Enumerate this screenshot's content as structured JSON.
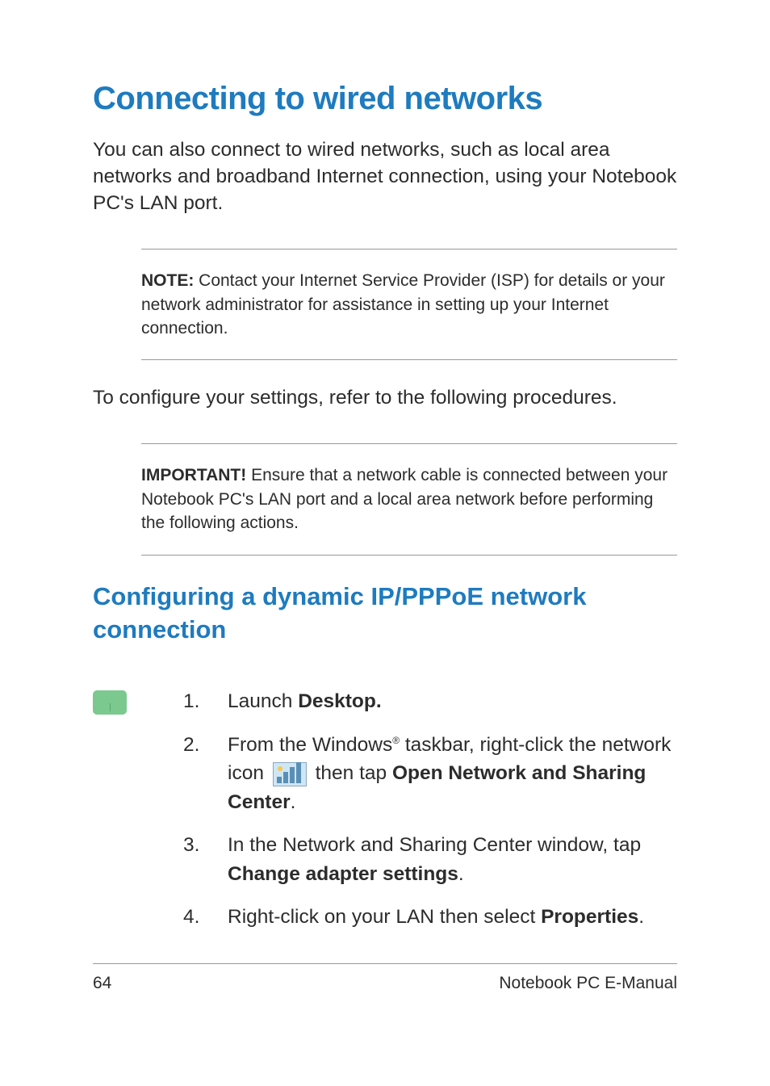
{
  "heading": "Connecting to wired networks",
  "intro": "You can also connect to wired networks, such as local area networks and broadband Internet connection, using your Notebook PC's LAN port.",
  "note": {
    "label": "NOTE:",
    "text": " Contact your Internet Service Provider (ISP) for details or your network administrator for assistance in setting up your Internet connection."
  },
  "configure_text": "To configure your settings, refer to the following procedures.",
  "important": {
    "label": "IMPORTANT!",
    "text": "  Ensure that a network cable is connected between your Notebook PC's LAN port and a local area network before performing the following actions."
  },
  "sub_heading": "Configuring a dynamic IP/PPPoE network connection",
  "steps": {
    "s1": {
      "num": "1.",
      "pre": "Launch ",
      "bold": "Desktop."
    },
    "s2": {
      "num": "2.",
      "pre": "From the Windows",
      "reg": "®",
      "mid": " taskbar, right-click the network icon ",
      "post": " then tap ",
      "bold": "Open Network and Sharing Center",
      "end": "."
    },
    "s3": {
      "num": "3.",
      "pre": "In the Network and Sharing Center window, tap ",
      "bold": "Change adapter settings",
      "end": "."
    },
    "s4": {
      "num": "4.",
      "pre": "Right-click on your LAN then select ",
      "bold": "Properties",
      "end": "."
    }
  },
  "footer": {
    "page": "64",
    "title": "Notebook PC E-Manual"
  }
}
